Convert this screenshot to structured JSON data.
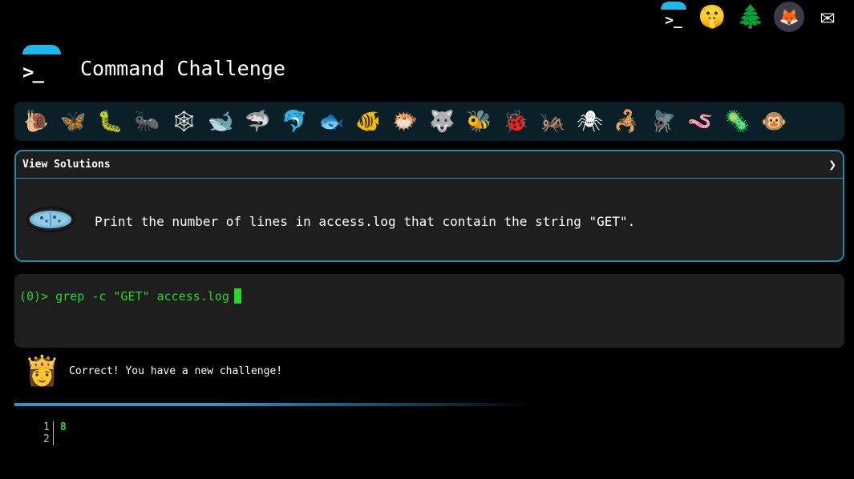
{
  "top_icons": [
    {
      "name": "command-challenge-icon",
      "glyph": ">_"
    },
    {
      "name": "shushing-face-icon",
      "glyph": "🤫"
    },
    {
      "name": "tree-icon",
      "glyph": "🌲"
    },
    {
      "name": "gitlab-icon",
      "glyph": "🦊"
    },
    {
      "name": "mail-icon",
      "glyph": "✉"
    }
  ],
  "header": {
    "logo_glyph": ">_",
    "title": "Command Challenge"
  },
  "animals": [
    {
      "name": "snail-icon",
      "glyph": "🐌"
    },
    {
      "name": "butterfly-icon",
      "glyph": "🦋"
    },
    {
      "name": "caterpillar-icon",
      "glyph": "🐛"
    },
    {
      "name": "ant-icon",
      "glyph": "🐜"
    },
    {
      "name": "spider-web-icon",
      "glyph": "🕸"
    },
    {
      "name": "whale-icon",
      "glyph": "🐋"
    },
    {
      "name": "shark-icon",
      "glyph": "🦈"
    },
    {
      "name": "dolphin-icon",
      "glyph": "🐬"
    },
    {
      "name": "fish-icon",
      "glyph": "🐟"
    },
    {
      "name": "tropical-fish-icon",
      "glyph": "🐠"
    },
    {
      "name": "blowfish-icon",
      "glyph": "🐡"
    },
    {
      "name": "wolf-icon",
      "glyph": "🐺"
    },
    {
      "name": "bee-icon",
      "glyph": "🐝"
    },
    {
      "name": "ladybug-icon",
      "glyph": "🐞"
    },
    {
      "name": "cricket-icon",
      "glyph": "🦗"
    },
    {
      "name": "spider-icon",
      "glyph": "🕷"
    },
    {
      "name": "scorpion-icon",
      "glyph": "🦂"
    },
    {
      "name": "fly-icon",
      "glyph": "🪰"
    },
    {
      "name": "worm-icon",
      "glyph": "🪱"
    },
    {
      "name": "microbe-icon",
      "glyph": "🦠"
    },
    {
      "name": "monkey-icon",
      "glyph": "🐵"
    }
  ],
  "solutions_panel": {
    "header_label": "View Solutions",
    "chevron": "❯",
    "challenge_icon": "microbe-icon",
    "challenge_text": "Print the number of lines in access.log that contain the string \"GET\"."
  },
  "terminal": {
    "prompt": "(0)>",
    "command": "grep -c \"GET\" access.log"
  },
  "feedback": {
    "avatar_glyph": "👸",
    "message": "Correct! You have a new challenge!"
  },
  "output": {
    "line_numbers": [
      "1",
      "2"
    ],
    "lines": [
      "8",
      ""
    ]
  },
  "colors": {
    "accent": "#1eb8ec",
    "terminal_green": "#2bd62b",
    "panel_border": "#1e8ab0",
    "panel_bg": "#1e1e1e",
    "animal_bar_bg": "#0a1f27"
  }
}
